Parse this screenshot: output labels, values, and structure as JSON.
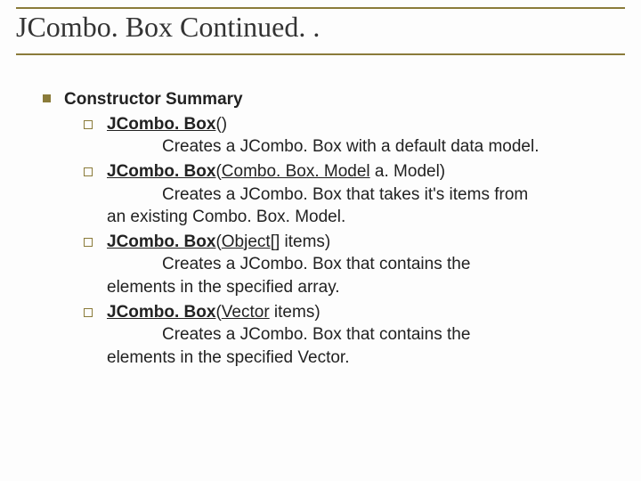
{
  "title": "JCombo. Box Continued. .",
  "section_title": "Constructor Summary",
  "constructors": [
    {
      "name": "JCombo. Box",
      "params_pre": "()",
      "params_link": "",
      "params_post": "",
      "desc1": "Creates a JCombo. Box with a default data model.",
      "desc2": ""
    },
    {
      "name": "JCombo. Box",
      "params_pre": "(",
      "params_link": "Combo. Box. Model",
      "params_post": " a. Model)",
      "desc1": "Creates a JCombo. Box that takes it's items from",
      "desc2": "an existing Combo. Box. Model."
    },
    {
      "name": "JCombo. Box",
      "params_pre": "(",
      "params_link": "Object",
      "params_post": "[] items)",
      "desc1": "Creates a JCombo. Box that contains the",
      "desc2": "elements in the specified array."
    },
    {
      "name": "JCombo. Box",
      "params_pre": "(",
      "params_link": "Vector",
      "params_post": " items)",
      "desc1": "Creates a JCombo. Box that contains the",
      "desc2": "elements in the specified Vector."
    }
  ]
}
